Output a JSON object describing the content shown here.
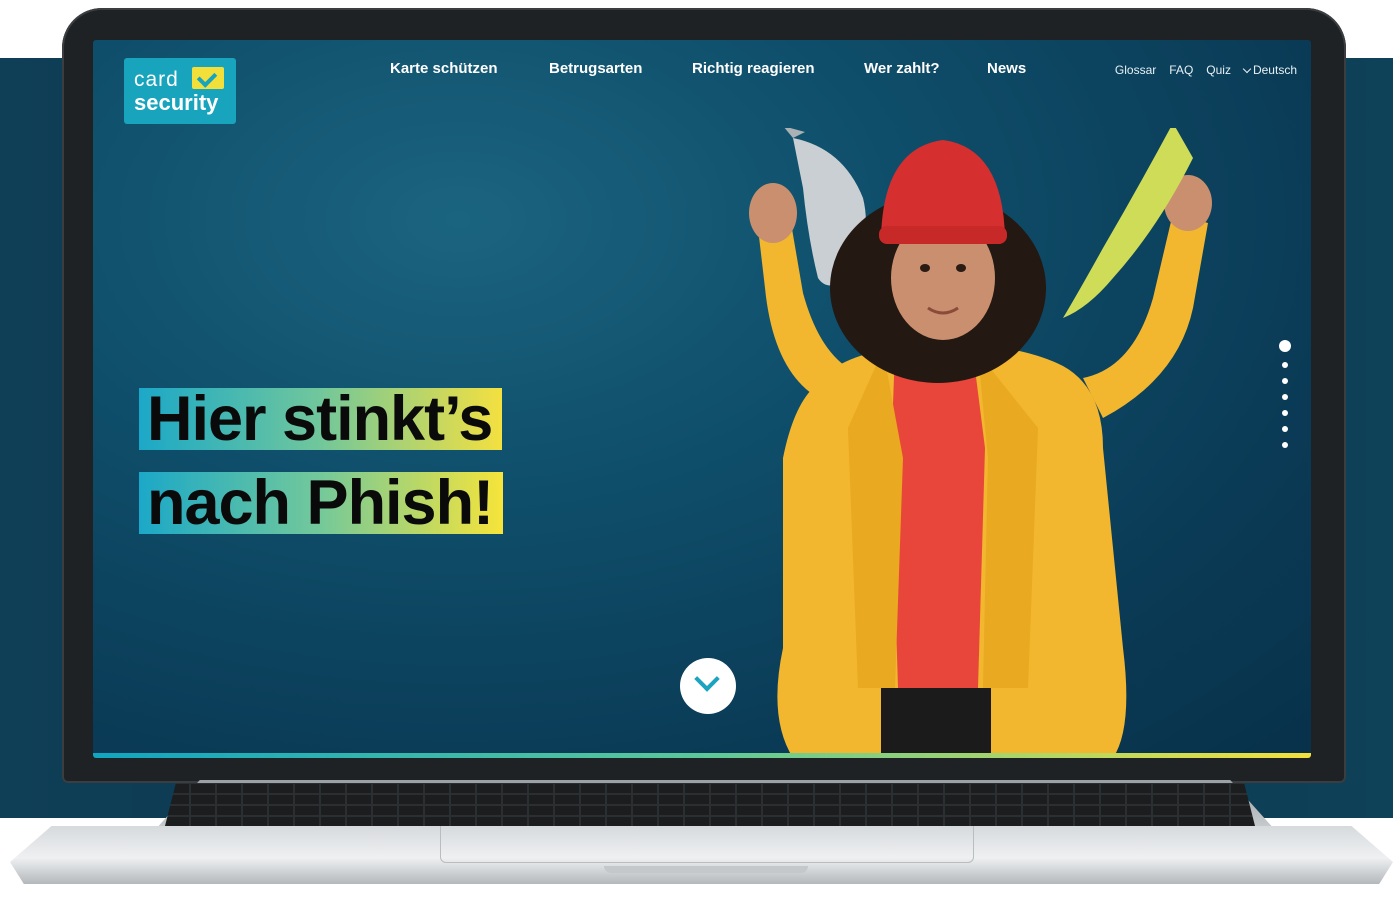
{
  "logo": {
    "line1": "card",
    "line2": "security"
  },
  "nav": {
    "main": [
      "Karte schützen",
      "Betrugsarten",
      "Richtig reagieren",
      "Wer zahlt?",
      "News"
    ],
    "side": [
      "Glossar",
      "FAQ",
      "Quiz"
    ],
    "language": "Deutsch"
  },
  "hero": {
    "line1": "Hier stinkt’s",
    "line2": "nach Phish!"
  },
  "slider": {
    "count": 7,
    "active": 0
  },
  "colors": {
    "brand_teal": "#19a4bd",
    "brand_yellow": "#f3df3a",
    "hero_background": "#0f4f6b"
  }
}
